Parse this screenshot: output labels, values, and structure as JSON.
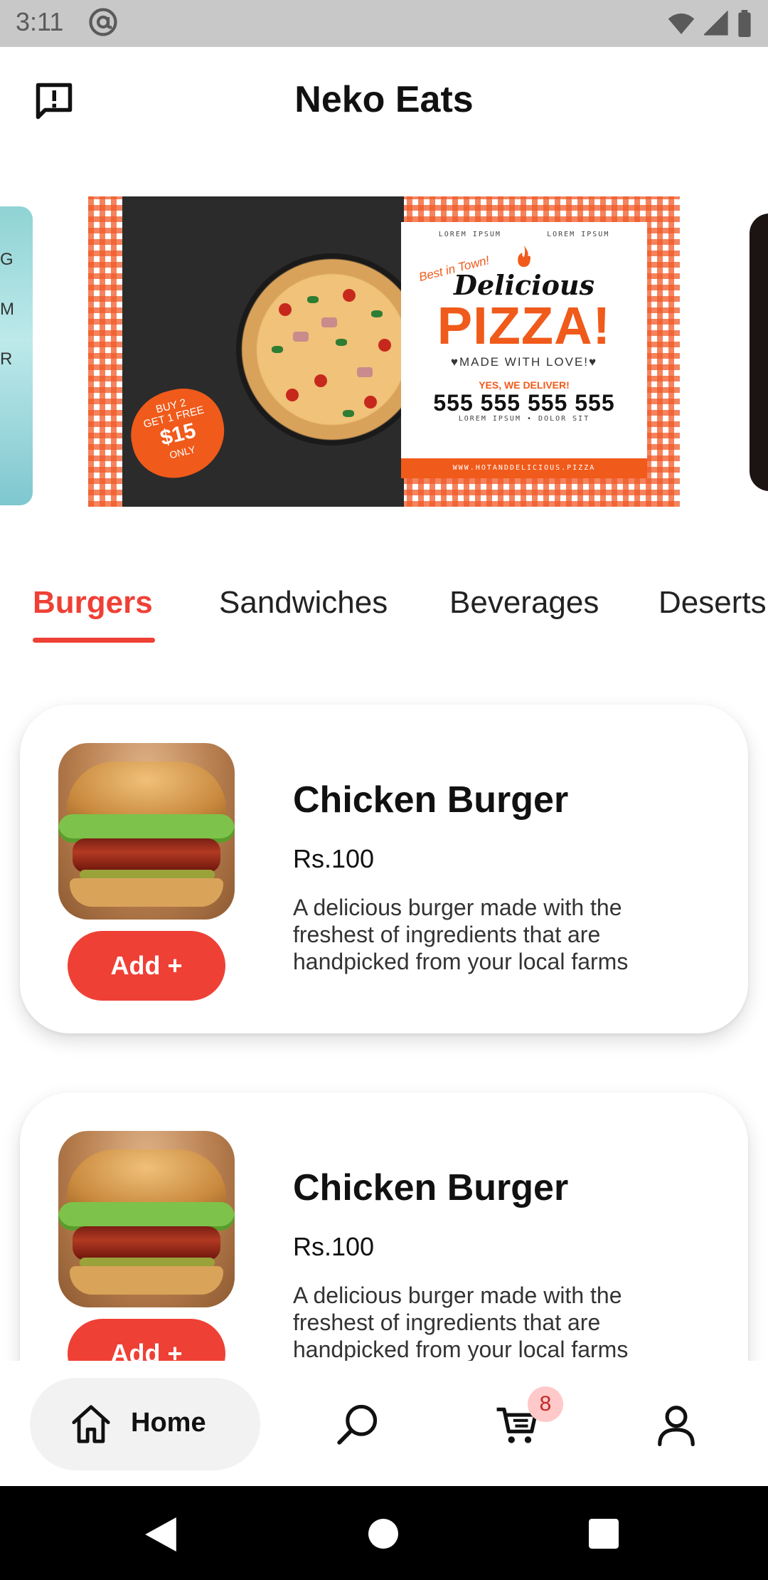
{
  "status_bar": {
    "time": "3:11",
    "icons": [
      "at-sign-icon",
      "wifi-icon",
      "signal-icon",
      "battery-icon"
    ]
  },
  "app_bar": {
    "title": "Neko Eats",
    "left_icon": "feedback-icon"
  },
  "banner": {
    "lorem_top": "LOREM IPSUM         LOREM IPSUM",
    "tagline": "Best in Town!",
    "headline_small": "Delicious",
    "headline_big": "PIZZA!",
    "made_with": "♥MADE WITH LOVE!♥",
    "deliver": "YES, WE DELIVER!",
    "phone": "555 555 555 555",
    "lorem_bottom": "LOREM IPSUM • DOLOR SIT",
    "url": "WWW.HOTANDDELICIOUS.PIZZA",
    "promo_line1": "BUY 2",
    "promo_line2": "GET 1 FREE",
    "promo_price": "$15",
    "promo_only": "ONLY"
  },
  "categories": {
    "active_index": 0,
    "items": [
      "Burgers",
      "Sandwiches",
      "Beverages",
      "Deserts"
    ]
  },
  "menu_items": [
    {
      "name": "Chicken Burger",
      "price": "Rs.100",
      "description": "A delicious burger made with the freshest of ingredients that are handpicked from your local farms",
      "add_label": "Add +"
    },
    {
      "name": "Chicken Burger",
      "price": "Rs.100",
      "description": "A delicious burger made with the freshest of ingredients that are handpicked from your local farms",
      "add_label": "Add +"
    }
  ],
  "bottom_nav": {
    "home_label": "Home",
    "cart_count": "8",
    "icons": [
      "home-icon",
      "search-icon",
      "cart-icon",
      "profile-icon"
    ]
  },
  "colors": {
    "accent": "#ef4036",
    "badge_bg": "#ffc9c9",
    "status_bar": "#c8c8c8",
    "pill_bg": "#f2f2f2"
  }
}
